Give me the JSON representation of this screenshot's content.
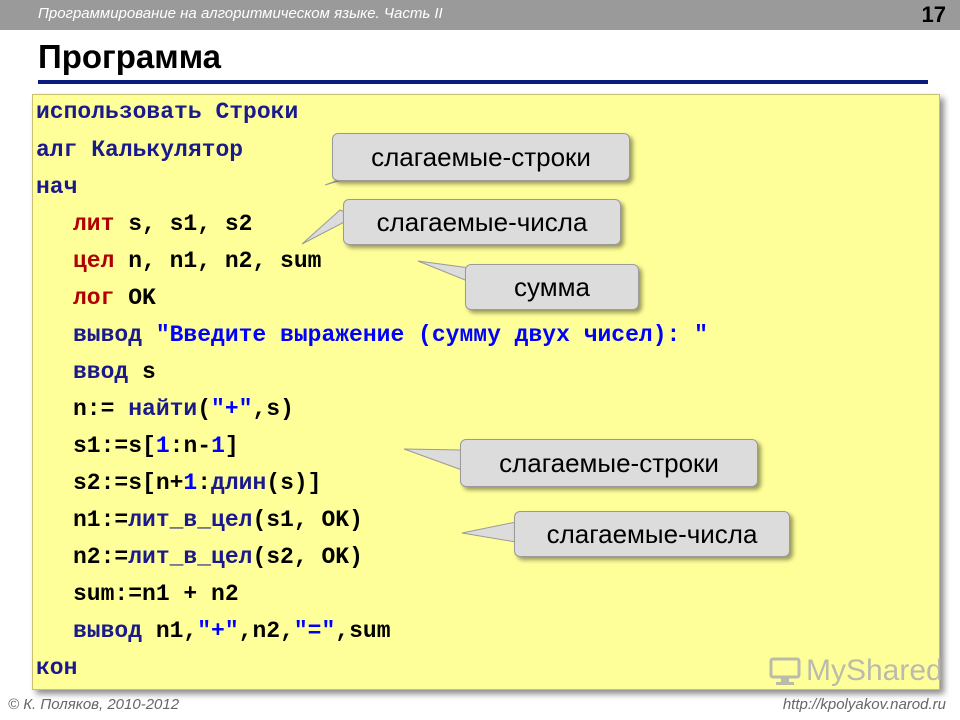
{
  "header": {
    "course": "Программирование на алгоритмическом языке. Часть II",
    "slide_number": "17"
  },
  "title": "Программа",
  "code": {
    "l1_kw": "использовать",
    "l1_rest": " Строки",
    "l2_kw": "алг",
    "l2_rest": " Калькулятор",
    "l3": "нач",
    "l4_kw": "лит",
    "l4_rest": " s, s1, s2",
    "l5_kw": "цел",
    "l5_rest": " n, n1, n2, sum",
    "l6_kw": "лог",
    "l6_rest": " OK",
    "l7_kw": "вывод",
    "l7_str": " \"Введите выражение (сумму двух чисел): \"",
    "l8_kw": "ввод",
    "l8_rest": " s",
    "l9_a": "n:= ",
    "l9_fn": "найти",
    "l9_b": "(",
    "l9_str": "\"+\"",
    "l9_c": ",s)",
    "l10_a": "s1:=s[",
    "l10_n1": "1",
    "l10_b": ":n-",
    "l10_n2": "1",
    "l10_c": "]",
    "l11_a": "s2:=s[n+",
    "l11_n1": "1",
    "l11_b": ":",
    "l11_fn": "длин",
    "l11_c": "(s)]",
    "l12_a": "n1:=",
    "l12_fn": "лит_в_цел",
    "l12_b": "(s1, OK)",
    "l13_a": "n2:=",
    "l13_fn": "лит_в_цел",
    "l13_b": "(s2, OK)",
    "l14": "sum:=n1 + n2",
    "l15_kw": "вывод",
    "l15_a": " n1,",
    "l15_s1": "\"+\"",
    "l15_b": ",n2,",
    "l15_s2": "\"=\"",
    "l15_c": ",sum",
    "l16": "кон"
  },
  "callouts": {
    "c1": "слагаемые-строки",
    "c2": "слагаемые-числа",
    "c3": "сумма",
    "c4": "слагаемые-строки",
    "c5": "слагаемые-числа"
  },
  "footer": {
    "left": "© К. Поляков, 2010-2012",
    "right": "http://kpolyakov.narod.ru"
  },
  "watermark": "MyShared",
  "colors": {
    "code_bg": "#ffff99",
    "title_rule": "#0a1c80",
    "keyword": "#1a1a8c",
    "declaration": "#b00000",
    "string": "#0000ff",
    "callout_bg": "#dcdcdc"
  }
}
